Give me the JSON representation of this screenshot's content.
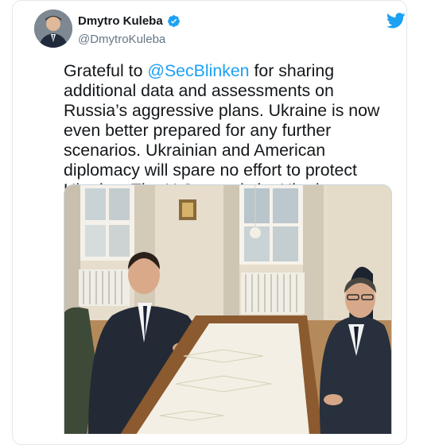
{
  "tweet": {
    "author": {
      "display_name": "Dmytro Kuleba",
      "handle": "@DmytroKuleba",
      "verified": true
    },
    "text_before": "Grateful to ",
    "mention": "@SecBlinken",
    "text_after": " for sharing additional data and assessments on Russia’s aggressive plans. Ukraine is now even better prepared for any further scenarios. Ukrainian and American diplomacy will spare no effort to protect Ukraine. The U.S. stands by Ukraine resolutely."
  },
  "icons": {
    "brand": "twitter-bird-icon",
    "verified": "verified-badge-icon"
  },
  "colors": {
    "accent": "#1da1f2",
    "text": "#14171a",
    "secondary": "#657786",
    "border": "#e1e8ed"
  }
}
